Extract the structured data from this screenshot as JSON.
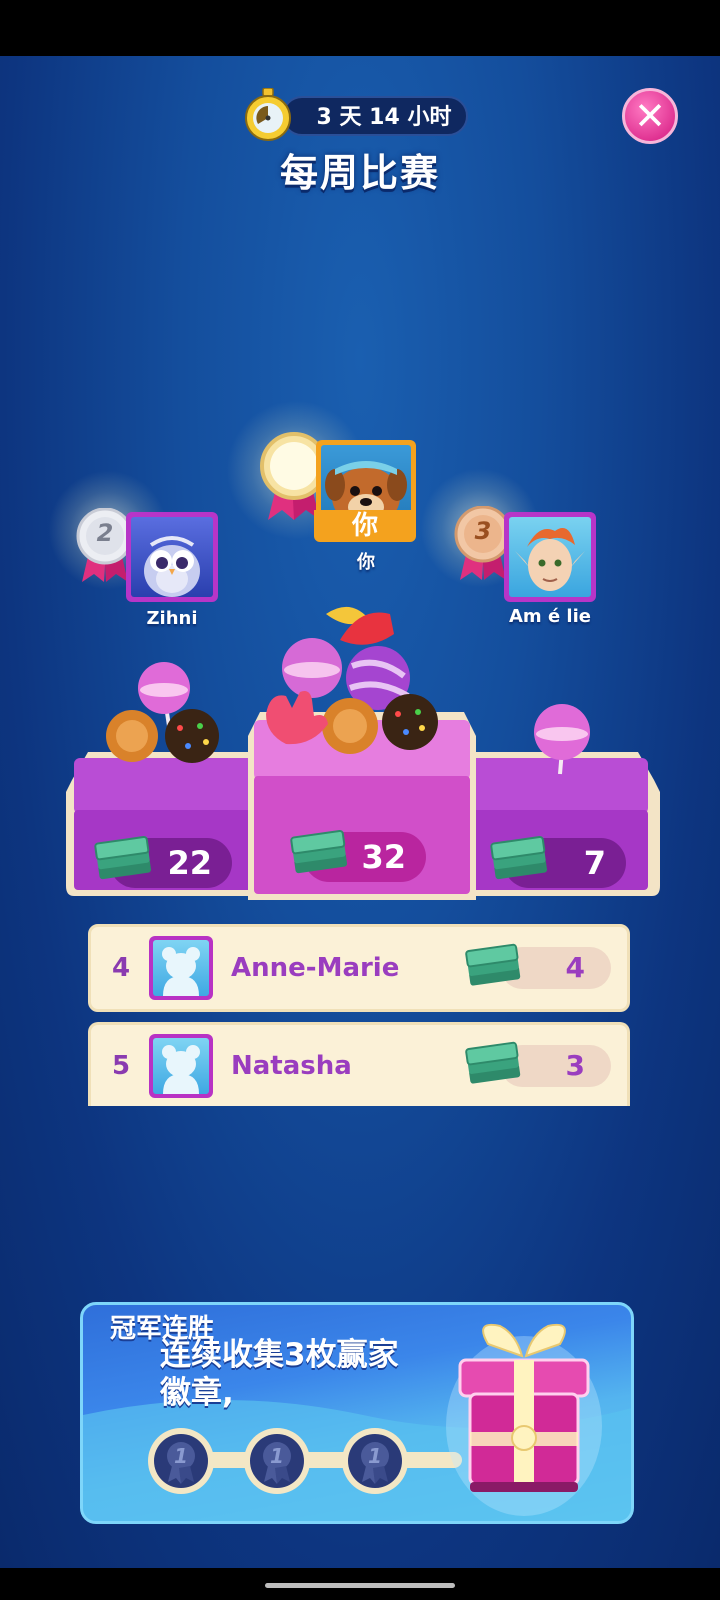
{
  "header": {
    "timer": "3 天 14 小时",
    "title": "每周比赛",
    "close_icon": "close-icon"
  },
  "podium": [
    {
      "rank": 1,
      "name": "你",
      "badge_label": "你",
      "score": "32",
      "medal": "gold-medal"
    },
    {
      "rank": 2,
      "name": "Zihni",
      "score": "22",
      "medal": "silver-medal",
      "medal_number": "2"
    },
    {
      "rank": 3,
      "name": "Am é lie",
      "score": "7",
      "medal": "bronze-medal",
      "medal_number": "3"
    }
  ],
  "leaderboard": [
    {
      "rank": "4",
      "name": "Anne-Marie",
      "score": "4"
    },
    {
      "rank": "5",
      "name": "Natasha",
      "score": "3"
    }
  ],
  "streak": {
    "title": "冠军连胜",
    "description": "连续收集3枚赢家徽章,",
    "badge_number": "1",
    "badges_collected": 0,
    "badges_total": 3
  },
  "colors": {
    "background": "#144e9d",
    "close_button": "#e0278f",
    "podium": "#c04ad8",
    "row_background": "#fbf1d7",
    "row_text": "#9a3dbf",
    "banner": "#3b86ea"
  }
}
